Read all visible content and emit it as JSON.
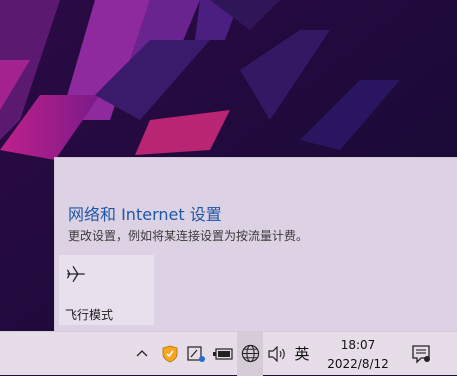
{
  "network_flyout": {
    "title": "网络和 Internet 设置",
    "subtitle": "更改设置，例如将某连接设置为按流量计费。",
    "tiles": [
      {
        "label": "飞行模式",
        "icon": "airplane-icon"
      }
    ]
  },
  "taskbar": {
    "tray_icons": [
      "chevron-up-icon",
      "security-shield-icon",
      "pen-icon",
      "battery-icon",
      "network-globe-icon",
      "volume-icon"
    ],
    "ime_label": "英",
    "time": "18:07",
    "date": "2022/8/12",
    "notification_icon": "action-center-icon"
  },
  "colors": {
    "flyout_bg": "#ddd2e3",
    "tile_bg": "#e9e0ee",
    "title_color": "#1f57a8",
    "taskbar_bg": "#e6dde8"
  }
}
